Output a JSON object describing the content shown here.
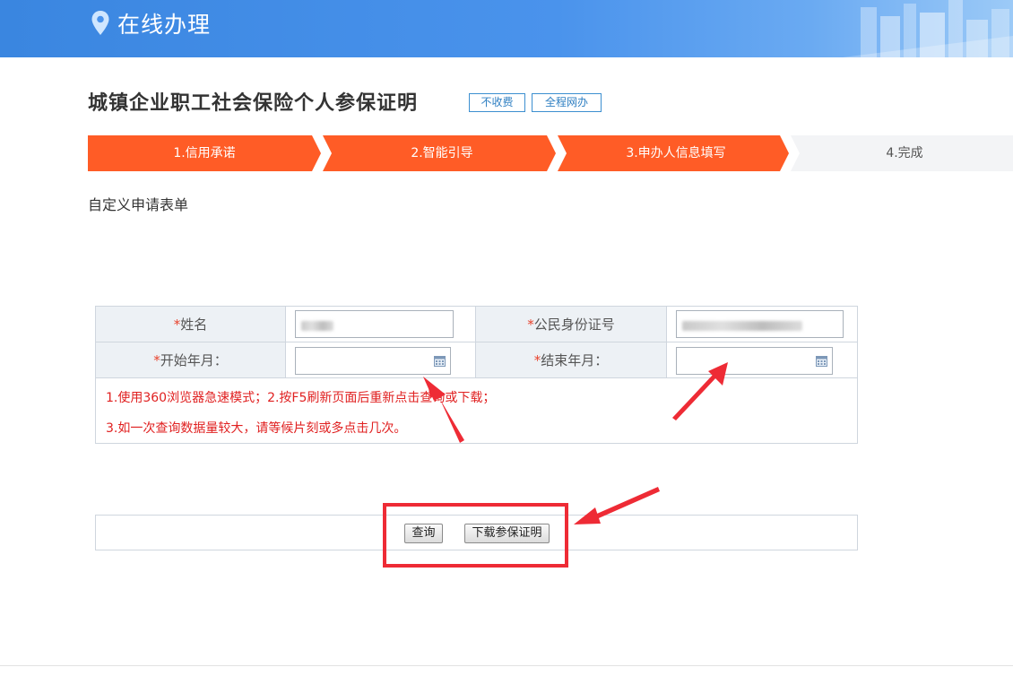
{
  "header": {
    "title": "在线办理"
  },
  "page": {
    "title": "城镇企业职工社会保险个人参保证明",
    "tags": [
      "不收费",
      "全程网办"
    ]
  },
  "steps": [
    {
      "label": "1.信用承诺",
      "state": "active"
    },
    {
      "label": "2.智能引导",
      "state": "active"
    },
    {
      "label": "3.申办人信息填写",
      "state": "active"
    },
    {
      "label": "4.完成",
      "state": "pending"
    }
  ],
  "form": {
    "caption": "自定义申请表单",
    "required_mark": "*",
    "fields": {
      "name_label": "姓名",
      "id_label": "公民身份证号",
      "start_label": "开始年月：",
      "end_label": "结束年月："
    },
    "notes": [
      "1.使用360浏览器急速模式；2.按F5刷新页面后重新点击查询或下载；",
      "3.如一次查询数据量较大，请等候片刻或多点击几次。"
    ]
  },
  "actions": {
    "query_label": "查询",
    "download_label": "下载参保证明"
  },
  "colors": {
    "banner": "#3a86e0",
    "step_active": "#ff5c26",
    "step_pending": "#f3f4f6",
    "tag_border": "#3c8fd0",
    "note_text": "#e02020",
    "highlight": "#ee2b35"
  },
  "icons": [
    "location-pin-icon",
    "calendar-icon",
    "arrow-annotation"
  ]
}
